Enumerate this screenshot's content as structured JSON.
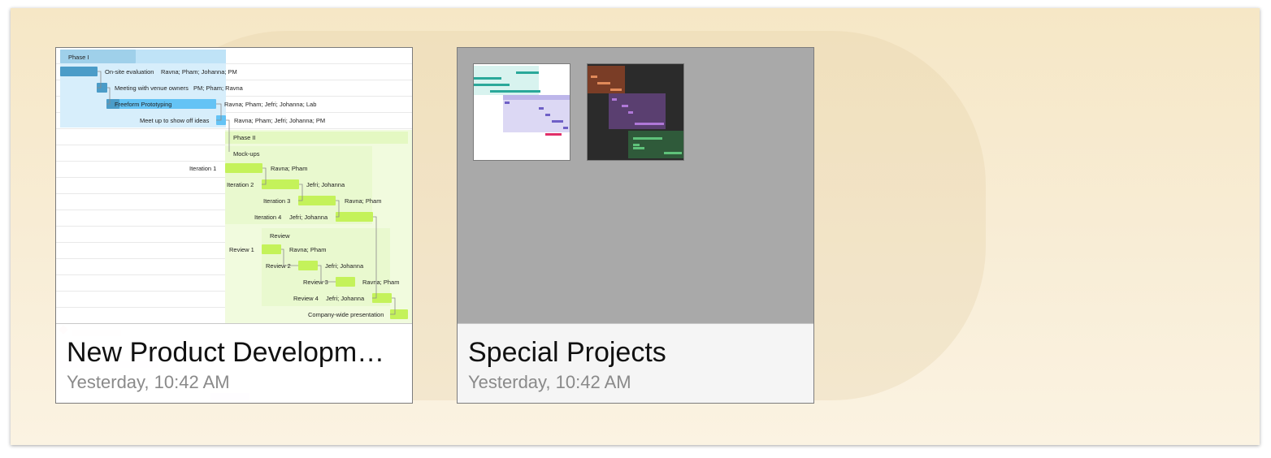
{
  "documents": [
    {
      "title": "New Product Developm…",
      "date": "Yesterday, 10:42 AM",
      "preview": {
        "phase1": "Phase I",
        "onsite": "On-site evaluation",
        "onsite_res": "Ravna; Pham; Johanna; PM",
        "meeting": "Meeting with venue owners",
        "meeting_res": "PM; Pham; Ravna",
        "freeform": "Freeform Prototyping",
        "freeform_res": "Ravna; Pham; Jefri; Johanna; Lab",
        "meetup": "Meet up to show off ideas",
        "meetup_res": "Ravna; Pham; Jefri; Johanna; PM",
        "phase2": "Phase II",
        "mockups": "Mock-ups",
        "it1": "Iteration 1",
        "it1_res": "Ravna; Pham",
        "it2": "Iteration 2",
        "it2_res": "Jefri; Johanna",
        "it3": "Iteration 3",
        "it3_res": "Ravna; Pham",
        "it4": "Iteration 4",
        "it4_res": "Jefri; Johanna",
        "review": "Review",
        "rv1": "Review 1",
        "rv1_res": "Ravna; Pham",
        "rv2": "Review 2",
        "rv2_res": "Jefri; Johanna",
        "rv3": "Review 3",
        "rv3_res": "Ravna; Pham",
        "rv4": "Review 4",
        "rv4_res": "Jefri; Johanna",
        "company": "Company-wide presentation"
      }
    },
    {
      "title": "Special Projects",
      "date": "Yesterday, 10:42 AM"
    }
  ],
  "colors": {
    "phase1_region": "#d7eefb",
    "phase1_header": "#a9d7f0",
    "blue_dark": "#4b9cc8",
    "blue_light": "#64c3f5",
    "phase2_region": "#f1fbde",
    "green_bar": "#c4f25a",
    "card2_preview_bg": "#a9a9a9"
  }
}
